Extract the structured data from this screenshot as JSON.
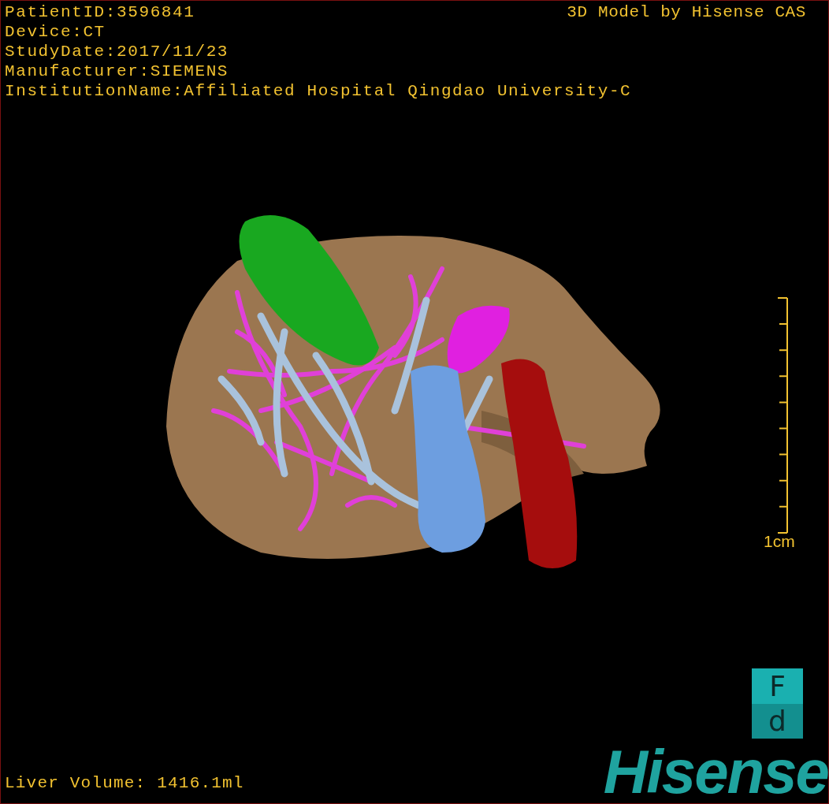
{
  "patient_info": [
    "PatientID:3596841",
    "Device:CT",
    "StudyDate:2017/11/23",
    "Manufacturer:SIEMENS",
    "InstitutionName:Affiliated Hospital Qingdao University-C"
  ],
  "model_credit": "3D Model by Hisense CAS",
  "scale_bar": {
    "label": "1cm"
  },
  "orientation_cube": {
    "front": "F",
    "bottom": "d"
  },
  "liver_volume": "Liver Volume: 1416.1ml",
  "logo": "Hisense"
}
